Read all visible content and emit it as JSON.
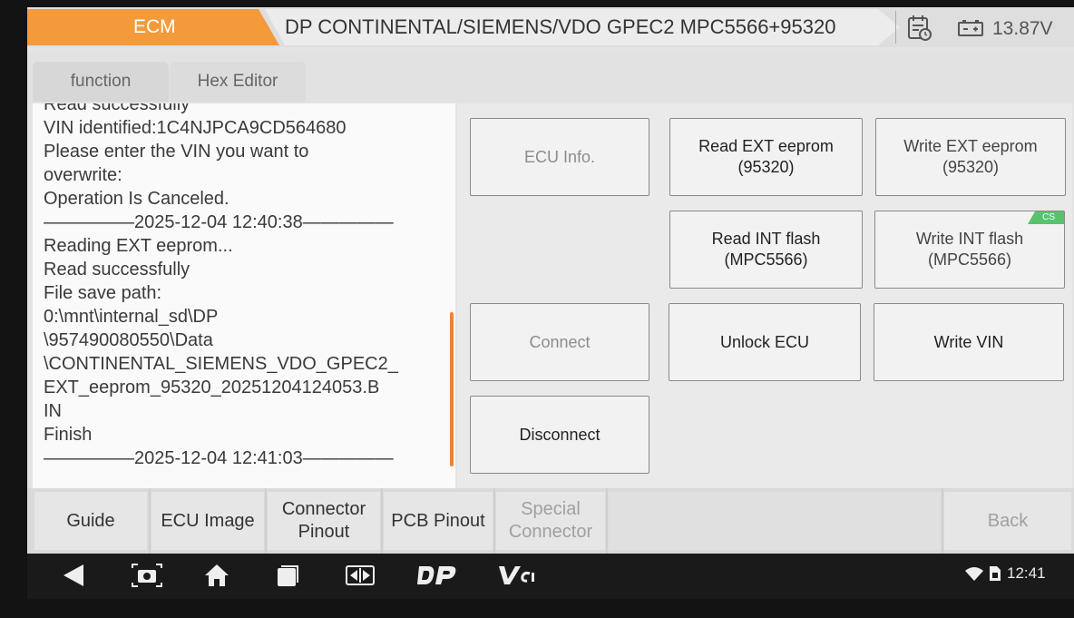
{
  "header": {
    "module_tab": "ECM",
    "model_title": "DP CONTINENTAL/SIEMENS/VDO GPEC2 MPC5566+95320",
    "voltage": "13.87V",
    "report_icon": "calendar-report-icon",
    "battery_icon": "battery-icon",
    "accent_color": "#f39a3b"
  },
  "tabs": {
    "function": "function",
    "hex_editor": "Hex Editor"
  },
  "log": {
    "lines": [
      "Read successfully",
      "VIN identified:1C4NJPCA9CD564680",
      "Please enter the VIN you want to",
      "overwrite:",
      "Operation Is Canceled.",
      "—————2025-12-04 12:40:38—————",
      "Reading EXT eeprom...",
      "Read successfully",
      "File save path:",
      "0:\\mnt\\internal_sd\\DP",
      "\\957490080550\\Data",
      "\\CONTINENTAL_SIEMENS_VDO_GPEC2_",
      "EXT_eeprom_95320_20251204124053.B",
      "IN",
      "Finish",
      "—————2025-12-04 12:41:03—————"
    ],
    "scrollbar_color": "#e8843c",
    "arrow_color": "#e02020"
  },
  "functions": {
    "ecu_info": "ECU Info.",
    "read_ext_eeprom": "Read EXT eeprom\n(95320)",
    "write_ext_eeprom": "Write EXT eeprom\n(95320)",
    "read_int_flash": "Read INT flash\n(MPC5566)",
    "write_int_flash": "Write INT flash\n(MPC5566)",
    "cs_badge": "CS",
    "connect": "Connect",
    "unlock_ecu": "Unlock ECU",
    "write_vin": "Write VIN",
    "disconnect": "Disconnect"
  },
  "bottom": {
    "guide": "Guide",
    "ecu_image": "ECU Image",
    "connector_pinout": "Connector\nPinout",
    "pcb_pinout": "PCB Pinout",
    "special_connector": "Special\nConnector",
    "back": "Back"
  },
  "navbar": {
    "icons": [
      "back-arrow-icon",
      "screenshot-icon",
      "home-icon",
      "recent-apps-icon",
      "screen-mirror-icon",
      "dp-logo-icon",
      "vci-logo-icon"
    ],
    "time": "12:41"
  }
}
